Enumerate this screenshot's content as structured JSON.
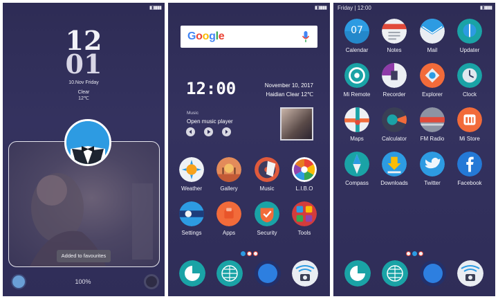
{
  "lockscreen": {
    "clock_hour": "12",
    "clock_minute": "01",
    "date": "10.Nov Friday",
    "weather": "Clear",
    "temperature": "12℃",
    "toast": "Added to favourites",
    "progress_label": "100%"
  },
  "homescreen": {
    "search_logo": "Google",
    "widget_time": "12:00",
    "widget_date": "November 10, 2017",
    "widget_weather": "Haidian  Clear  12℃",
    "music_title": "Music",
    "music_subtitle": "Open music player",
    "apps": [
      {
        "label": "Weather",
        "icon": "weather-icon"
      },
      {
        "label": "Gallery",
        "icon": "gallery-icon"
      },
      {
        "label": "Music",
        "icon": "music-icon"
      },
      {
        "label": "L.I.B.O",
        "icon": "libo-icon"
      },
      {
        "label": "Settings",
        "icon": "settings-icon"
      },
      {
        "label": "Apps",
        "icon": "apps-icon"
      },
      {
        "label": "Security",
        "icon": "security-icon"
      },
      {
        "label": "Tools",
        "icon": "tools-icon"
      }
    ]
  },
  "drawer": {
    "status_text": "Friday | 12:00",
    "apps": [
      {
        "label": "Calendar",
        "icon": "calendar-icon",
        "badge": "07"
      },
      {
        "label": "Notes",
        "icon": "notes-icon"
      },
      {
        "label": "Mail",
        "icon": "mail-icon"
      },
      {
        "label": "Updater",
        "icon": "updater-icon"
      },
      {
        "label": "Mi Remote",
        "icon": "remote-icon"
      },
      {
        "label": "Recorder",
        "icon": "recorder-icon"
      },
      {
        "label": "Explorer",
        "icon": "explorer-icon"
      },
      {
        "label": "Clock",
        "icon": "clock-icon"
      },
      {
        "label": "Maps",
        "icon": "maps-icon"
      },
      {
        "label": "Calculator",
        "icon": "calculator-icon"
      },
      {
        "label": "FM Radio",
        "icon": "radio-icon"
      },
      {
        "label": "Mi Store",
        "icon": "store-icon"
      },
      {
        "label": "Compass",
        "icon": "compass-icon"
      },
      {
        "label": "Downloads",
        "icon": "downloads-icon"
      },
      {
        "label": "Twitter",
        "icon": "twitter-icon"
      },
      {
        "label": "Facebook",
        "icon": "facebook-icon"
      }
    ]
  },
  "dock": [
    {
      "icon": "phone-icon"
    },
    {
      "icon": "browser-icon"
    },
    {
      "icon": "messages-icon"
    },
    {
      "icon": "camera-icon"
    }
  ],
  "colors": {
    "background": "#2f2d58",
    "accent_blue": "#2d9be2",
    "accent_orange": "#f26b3a",
    "accent_teal": "#1aa3a6"
  }
}
